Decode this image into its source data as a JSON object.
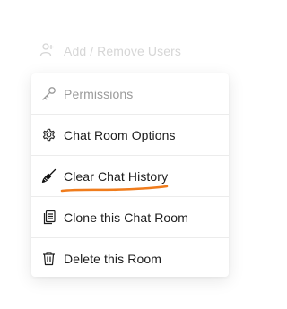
{
  "ghost_item": {
    "label": "Add / Remove Users",
    "icon": "user-add-icon"
  },
  "menu": {
    "items": [
      {
        "label": "Permissions",
        "icon": "key-icon",
        "disabled": true
      },
      {
        "label": "Chat Room Options",
        "icon": "gear-icon",
        "disabled": false
      },
      {
        "label": "Clear Chat History",
        "icon": "broom-icon",
        "disabled": false,
        "highlighted": true
      },
      {
        "label": "Clone this Chat Room",
        "icon": "copy-icon",
        "disabled": false
      },
      {
        "label": "Delete this Room",
        "icon": "trash-icon",
        "disabled": false
      }
    ]
  },
  "colors": {
    "highlight_underline": "#f07c1c",
    "disabled_text": "#9b9b9b",
    "text": "#1c1c1c",
    "ghost_text": "#d6d6d6"
  }
}
